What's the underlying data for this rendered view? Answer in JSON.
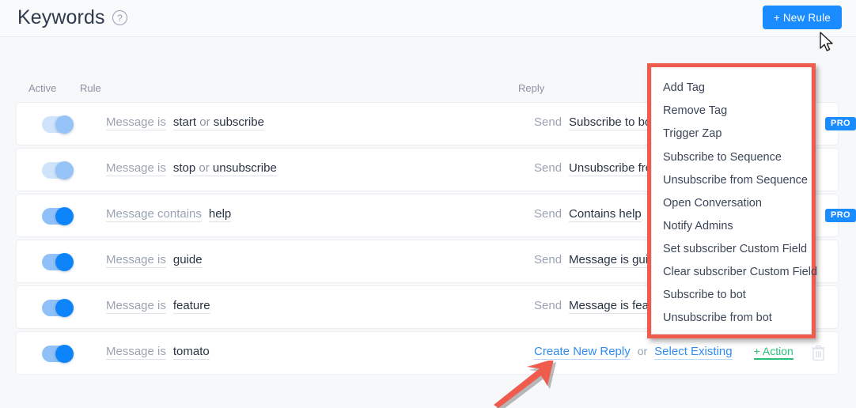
{
  "header": {
    "title": "Keywords",
    "help_icon": "question-mark-circle-icon",
    "new_rule_label": "+ New Rule",
    "accent_color": "#1a8cff"
  },
  "table": {
    "columns": {
      "active": "Active",
      "rule": "Rule",
      "reply": "Reply"
    },
    "rows": [
      {
        "active": true,
        "muted": true,
        "operator": "Message is",
        "value": "start or subscribe",
        "value_parts": [
          "start",
          " or ",
          "subscribe"
        ],
        "reply_action": "Send",
        "reply_value": "Subscribe to bot",
        "badge": "PRO"
      },
      {
        "active": true,
        "muted": true,
        "operator": "Message is",
        "value": "stop or unsubscribe",
        "value_parts": [
          "stop",
          " or ",
          "unsubscribe"
        ],
        "reply_action": "Send",
        "reply_value": "Unsubscribe from bot",
        "badge": ""
      },
      {
        "active": true,
        "muted": false,
        "operator": "Message contains",
        "value": "help",
        "reply_action": "Send",
        "reply_value": "Contains help",
        "badge": "PRO"
      },
      {
        "active": true,
        "muted": false,
        "operator": "Message is",
        "value": "guide",
        "reply_action": "Send",
        "reply_value": "Message is guide",
        "badge": ""
      },
      {
        "active": true,
        "muted": false,
        "operator": "Message is",
        "value": "feature",
        "reply_action": "Send",
        "reply_value": "Message is feature",
        "badge": ""
      },
      {
        "active": true,
        "muted": false,
        "operator": "Message is",
        "value": "tomato",
        "reply_action": "",
        "reply_value": "",
        "badge": ""
      }
    ],
    "last_row_links": {
      "create_new_reply": "Create New Reply",
      "or": "or",
      "select_existing": "Select Existing",
      "add_action": "+ Action",
      "delete_icon": "trash-icon",
      "green_color": "#28c07a",
      "link_color": "#2f8cf0"
    }
  },
  "dropdown": {
    "highlight_color": "#ef5b4c",
    "items": [
      "Add Tag",
      "Remove Tag",
      "Trigger Zap",
      "Subscribe to Sequence",
      "Unsubscribe from Sequence",
      "Open Conversation",
      "Notify Admins",
      "Set subscriber Custom Field",
      "Clear subscriber Custom Field",
      "Subscribe to bot",
      "Unsubscribe from bot"
    ]
  },
  "annotations": {
    "arrow": "red-arrow-pointing-to-create-new-reply",
    "arrow_color": "#ef5b4c",
    "cursor": "mouse-pointer-arrow"
  }
}
